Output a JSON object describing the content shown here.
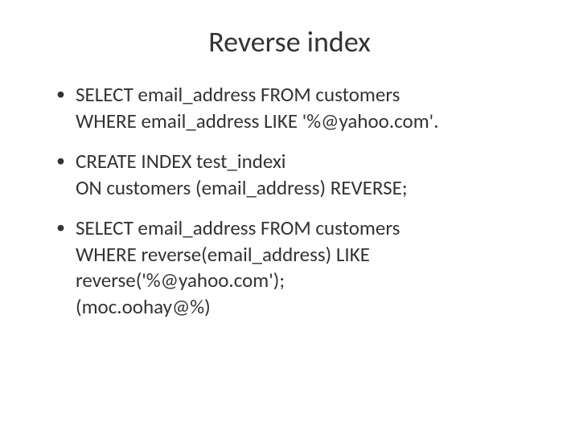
{
  "title": "Reverse index",
  "bullets": [
    {
      "lines": [
        "SELECT email_address FROM customers",
        "WHERE email_address LIKE '%@yahoo.com'."
      ]
    },
    {
      "lines": [
        "CREATE INDEX test_indexi",
        "ON customers (email_address) REVERSE;"
      ]
    },
    {
      "lines": [
        "SELECT email_address FROM customers",
        "WHERE reverse(email_address) LIKE",
        "reverse('%@yahoo.com');",
        "(moc.oohay@%)"
      ]
    }
  ]
}
